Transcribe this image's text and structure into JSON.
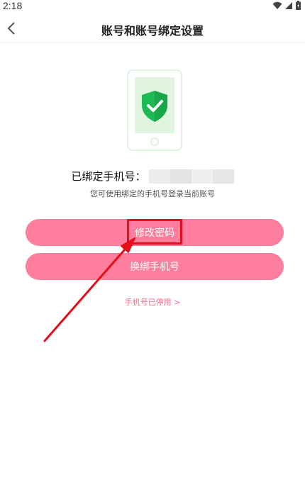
{
  "status_bar": {
    "time": "2:18"
  },
  "nav": {
    "title": "账号和账号绑定设置"
  },
  "account": {
    "bound_label": "已绑定手机号：",
    "hint": "您可使用绑定的手机号登录当前账号"
  },
  "actions": {
    "change_password": "修改密码",
    "rebind_phone": "换绑手机号",
    "phone_disabled": "手机号已停用 >"
  },
  "colors": {
    "accent_pink": "#ff7e9d",
    "link_pink": "#ff6a8a",
    "annotation_red": "#e3101c",
    "shield_green": "#1db954"
  }
}
